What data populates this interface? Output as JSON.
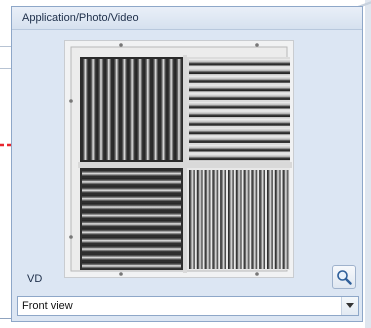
{
  "panel": {
    "title": "Application/Photo/Video",
    "image_alt": "air vent grille front view",
    "label": "VD"
  },
  "zoom_button": {
    "icon": "magnifier-icon"
  },
  "view_select": {
    "value": "Front view"
  },
  "annotation": {
    "arrow_color": "#e8262e"
  },
  "colors": {
    "panel_bg": "#dce6f3",
    "panel_border": "#8ea7c8"
  }
}
